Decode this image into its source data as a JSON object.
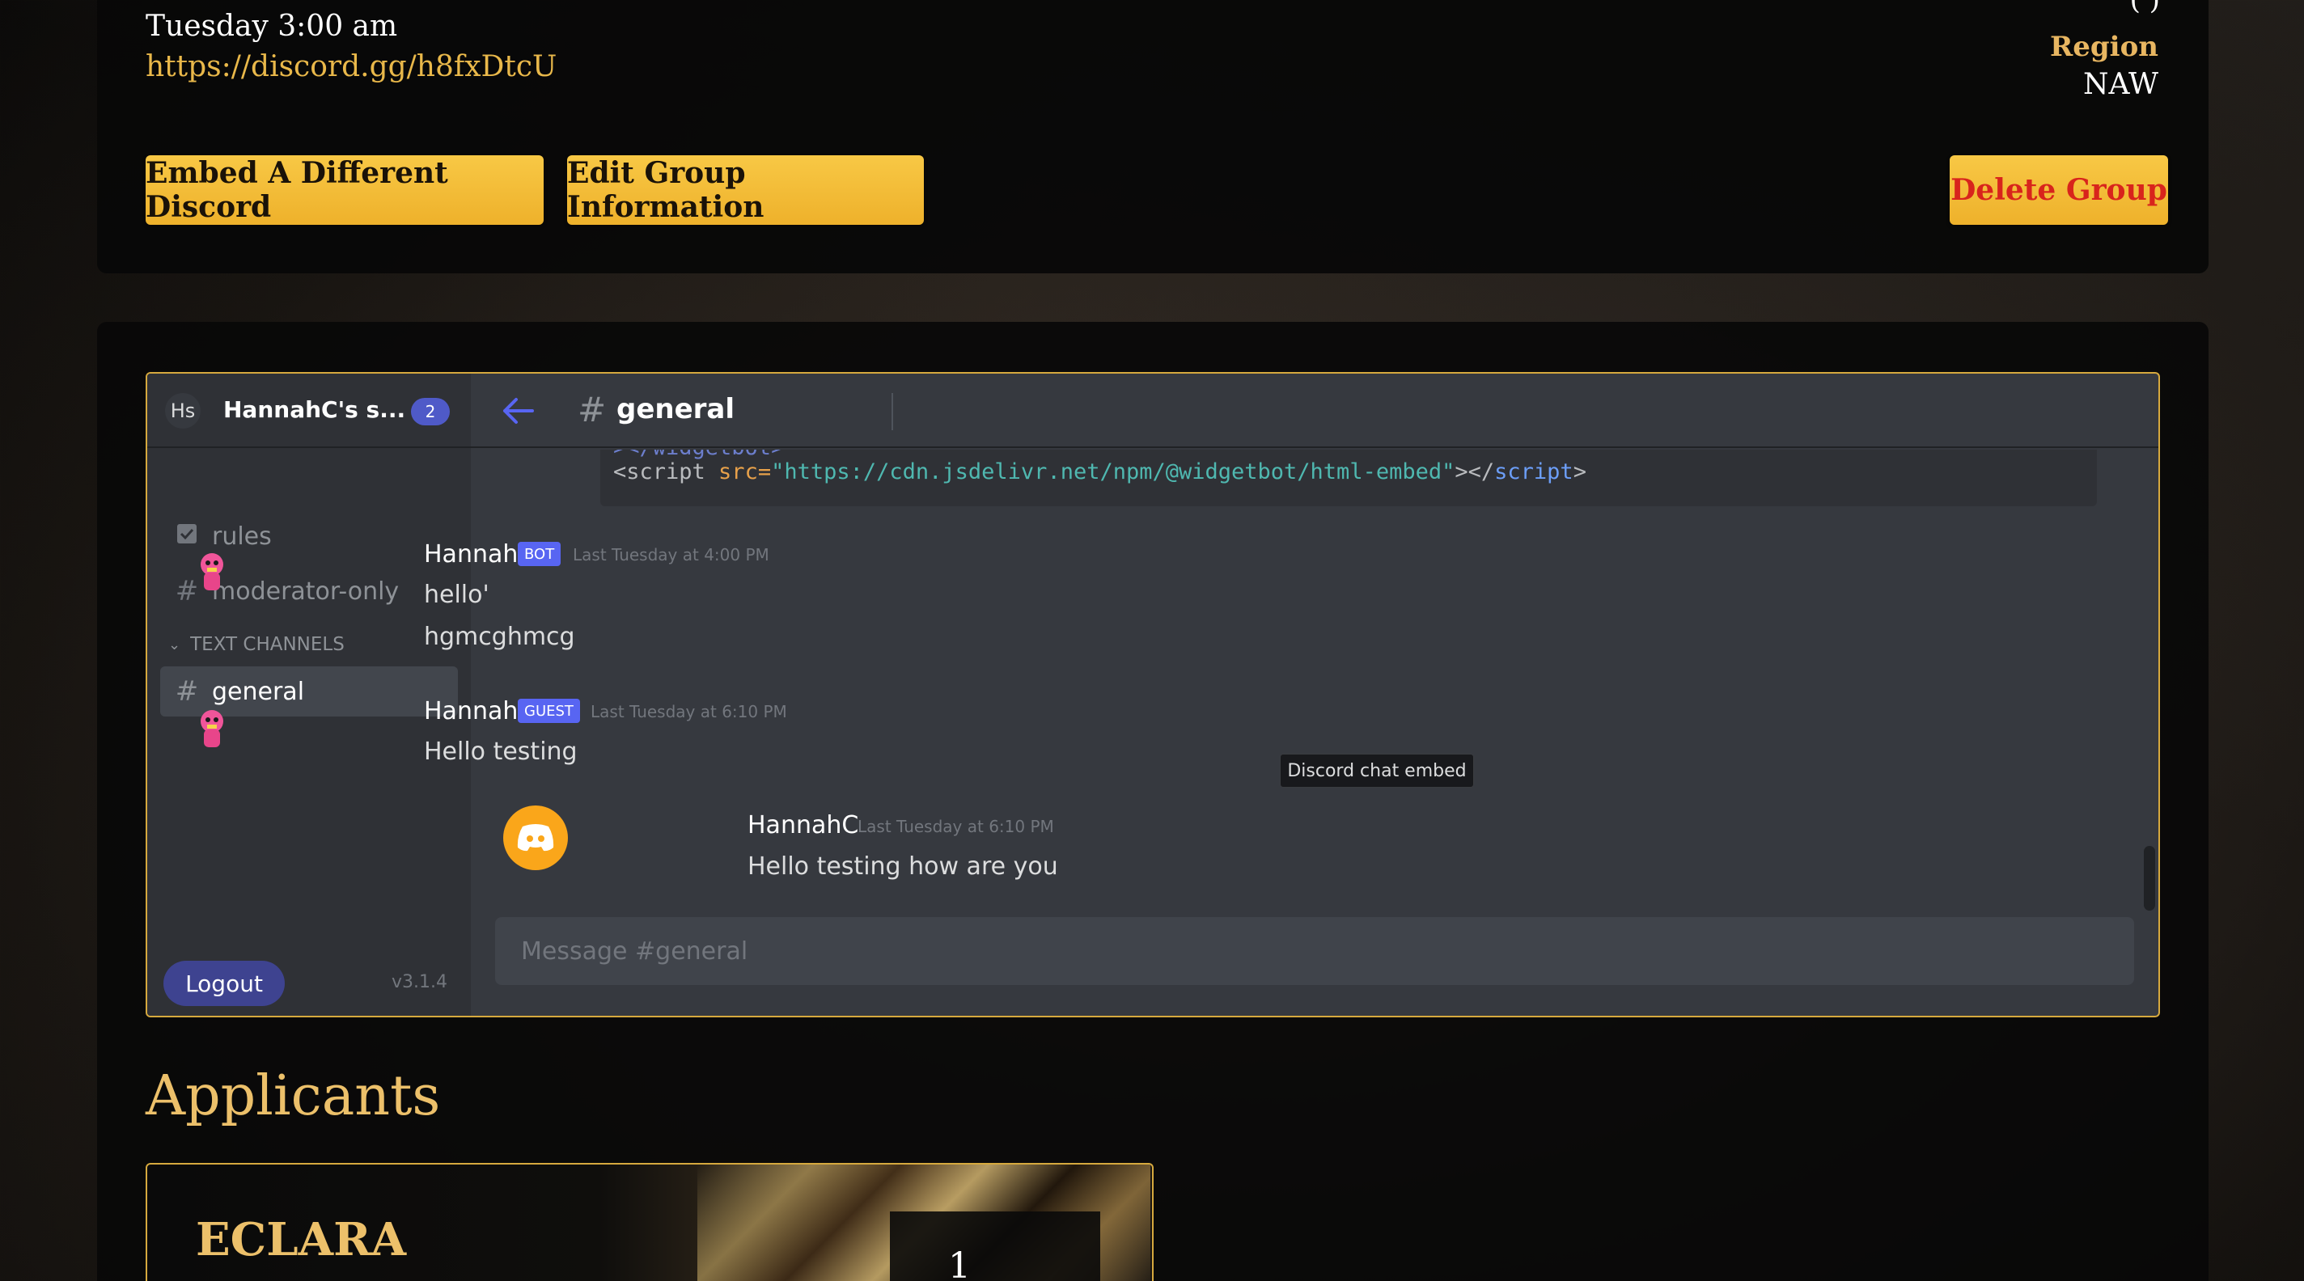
{
  "group": {
    "time": "Tuesday 3:00 am",
    "discord_link": "https://discord.gg/h8fxDtcU",
    "region_label": "Region",
    "region_value": "NAW",
    "region_partial": "(          )"
  },
  "actions": {
    "embed_label": "Embed A Different Discord",
    "edit_label": "Edit Group Information",
    "delete_label": "Delete Group"
  },
  "discord": {
    "server_initials": "Hs",
    "server_name": "HannahC's s...",
    "server_count": "2",
    "channels": [
      {
        "label": "rules",
        "icon": "rules-icon"
      },
      {
        "label": "moderator-only",
        "icon": "hash-icon"
      }
    ],
    "category": "TEXT CHANNELS",
    "active_channel": "general",
    "logout_label": "Logout",
    "version": "v3.1.4",
    "header_channel": "general",
    "code_cut": "></widgetbot>",
    "code": {
      "open_tag": "<script",
      "attr": " src=",
      "value": "\"https://cdn.jsdelivr.net/npm/@widgetbot/html-embed\"",
      "close": "></",
      "close_tag": "script",
      "end": ">"
    },
    "messages": [
      {
        "author": "Hannah",
        "badge": "BOT",
        "time": "Last Tuesday at 4:00 PM",
        "lines": [
          "hello'",
          "hgmcghmcg"
        ]
      },
      {
        "author": "Hannah",
        "badge": "GUEST",
        "time": "Last Tuesday at 6:10 PM",
        "lines": [
          "Hello testing"
        ]
      },
      {
        "author": "HannahC",
        "badge": "",
        "time": "Last Tuesday at 6:10 PM",
        "lines": [
          "Hello testing how are you"
        ]
      }
    ],
    "tooltip": "Discord chat embed",
    "input_placeholder": "Message #general"
  },
  "applicants": {
    "title": "Applicants",
    "cards": [
      {
        "name": "ECLARA",
        "rank": "1"
      }
    ]
  },
  "colors": {
    "gold": "#eeb12b",
    "accent_text": "#e8b661",
    "danger": "#d8241c",
    "discord_blurple": "#5865f2"
  }
}
